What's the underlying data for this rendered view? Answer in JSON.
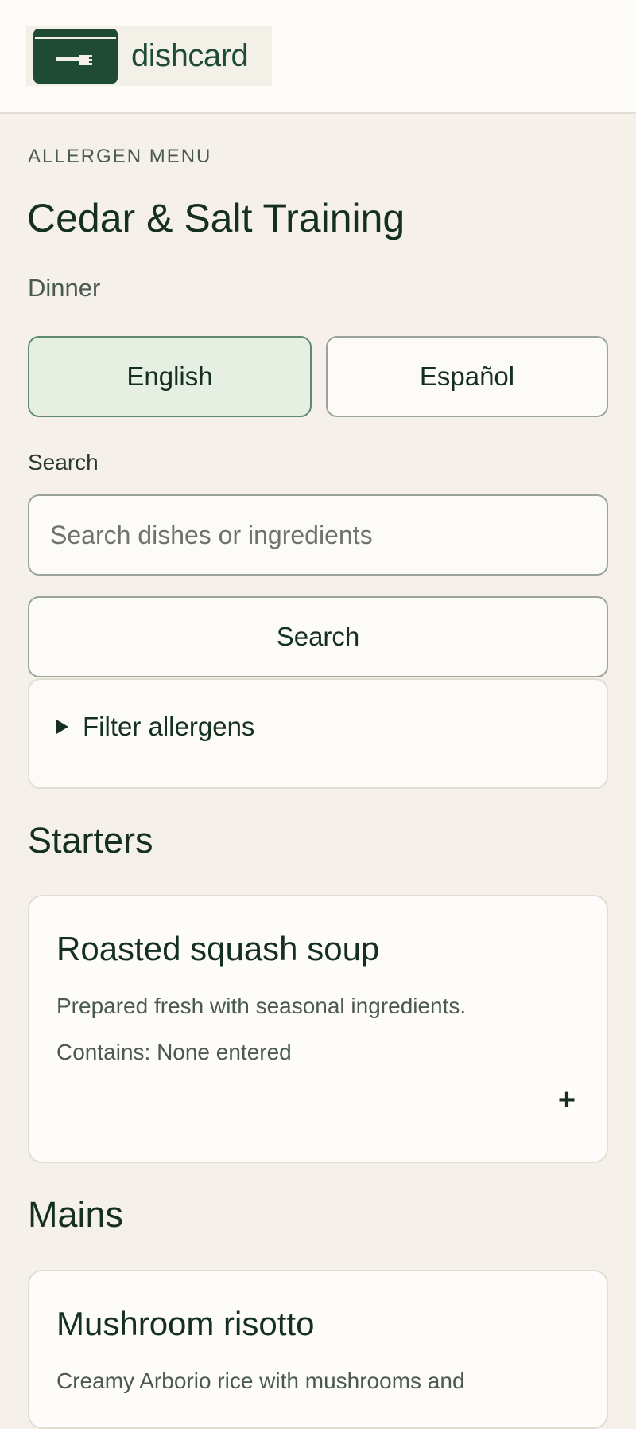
{
  "brand": {
    "name": "dishcard",
    "logo_icon": "plate-fork-icon",
    "colors": {
      "primary": "#1e4a36",
      "accent_bg": "#e5efe2"
    }
  },
  "menu": {
    "eyebrow": "ALLERGEN MENU",
    "title": "Cedar & Salt Training",
    "service": "Dinner"
  },
  "languages": [
    {
      "label": "English",
      "selected": true
    },
    {
      "label": "Español",
      "selected": false
    }
  ],
  "search": {
    "label": "Search",
    "placeholder": "Search dishes or ingredients",
    "value": "",
    "button_label": "Search"
  },
  "filter": {
    "label": "Filter allergens",
    "expanded": false
  },
  "sections": [
    {
      "heading": "Starters",
      "dishes": [
        {
          "name": "Roasted squash soup",
          "description": "Prepared fresh with seasonal ingredients.",
          "contains": "Contains: None entered",
          "expand_label": "+"
        }
      ]
    },
    {
      "heading": "Mains",
      "dishes": [
        {
          "name": "Mushroom risotto",
          "description": "Creamy Arborio rice with mushrooms and"
        }
      ]
    }
  ]
}
